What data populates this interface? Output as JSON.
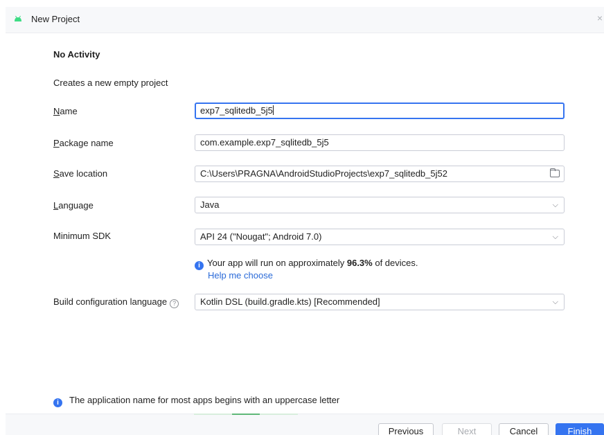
{
  "window": {
    "title": "New Project",
    "close_glyph": "×",
    "logo_icon": "android-icon"
  },
  "template": {
    "heading": "No Activity",
    "description": "Creates a new empty project"
  },
  "form": {
    "name": {
      "label_mnemonic": "N",
      "label_rest": "ame",
      "value": "exp7_sqlitedb_5j5"
    },
    "package": {
      "label_mnemonic": "P",
      "label_rest": "ackage name",
      "value": "com.example.exp7_sqlitedb_5j5"
    },
    "save_location": {
      "label_mnemonic": "S",
      "label_rest": "ave location",
      "value": "C:\\Users\\PRAGNA\\AndroidStudioProjects\\exp7_sqlitedb_5j52"
    },
    "language": {
      "label_mnemonic": "L",
      "label_rest": "anguage",
      "value": "Java"
    },
    "min_sdk": {
      "label": "Minimum SDK",
      "value": "API 24 (\"Nougat\"; Android 7.0)"
    },
    "build_config": {
      "label": "Build configuration language",
      "value": "Kotlin DSL (build.gradle.kts) [Recommended]",
      "help_glyph": "?"
    }
  },
  "sdk_info": {
    "prefix": "Your app will run on approximately ",
    "percent": "96.3%",
    "suffix": " of devices.",
    "help_link": "Help me choose"
  },
  "notice": {
    "text": "The application name for most apps begins with an uppercase letter",
    "icon_glyph": "i"
  },
  "buttons": {
    "previous": "Previous",
    "next": "Next",
    "cancel": "Cancel",
    "finish": "Finish"
  },
  "dropdown_glyph": "⌵",
  "colors": {
    "accent": "#3574f0",
    "link": "#2a6ad8",
    "android_green": "#3ddc84"
  }
}
